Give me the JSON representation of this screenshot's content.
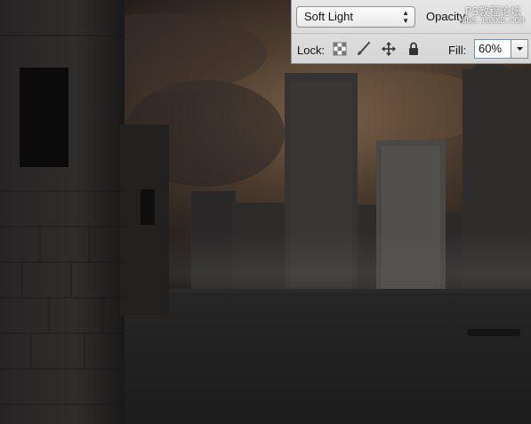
{
  "layers_panel": {
    "blend_mode": {
      "value": "Soft Light"
    },
    "opacity": {
      "label": "Opacity:"
    },
    "lock": {
      "label": "Lock:",
      "icons": [
        "transparent-pixels-lock-icon",
        "brush-icon",
        "move-arrows-icon",
        "padlock-icon"
      ]
    },
    "fill": {
      "label": "Fill:",
      "value": "60%"
    }
  },
  "watermark": {
    "line1": "PS教程论坛",
    "line2": "BBS.16XX8.COM"
  }
}
